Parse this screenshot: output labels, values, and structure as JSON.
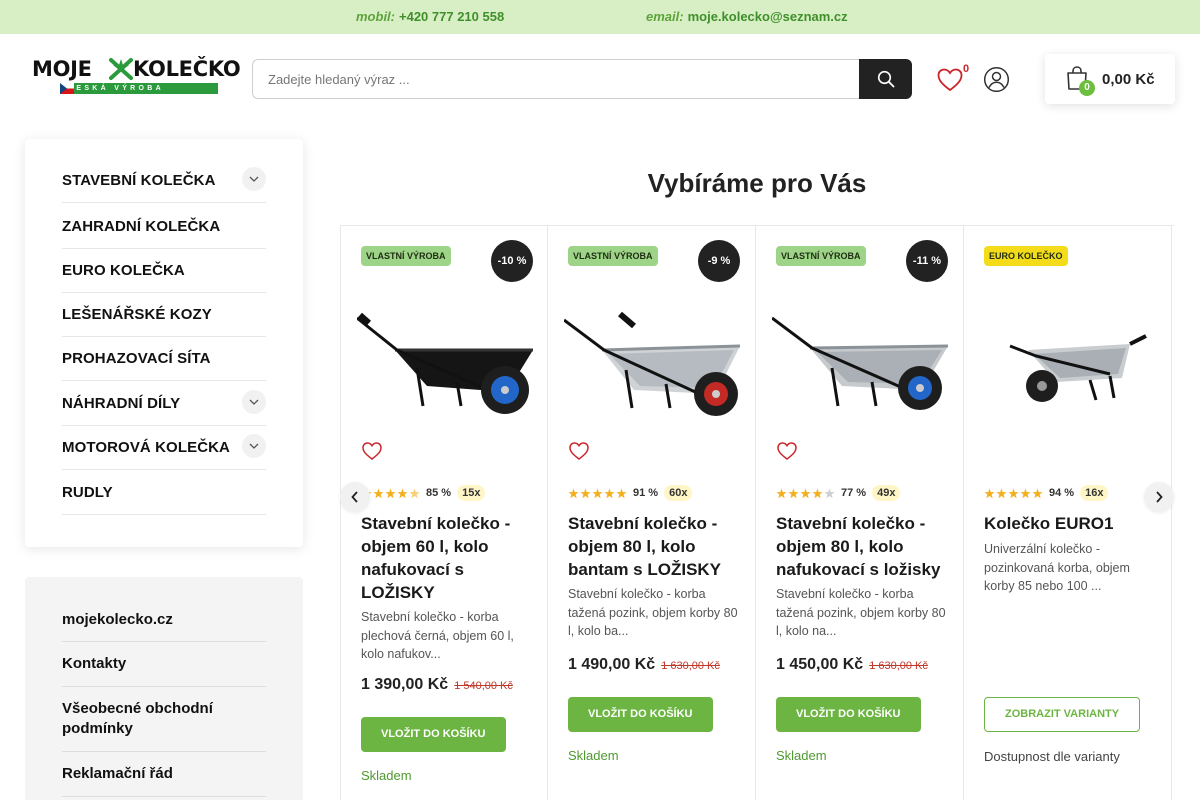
{
  "topbar": {
    "phone_label": "mobil:",
    "phone": "+420 777 210 558",
    "email_label": "email:",
    "email": "moje.kolecko@seznam.cz"
  },
  "logo": {
    "word1": "MOJE",
    "word2": "KOLEČKO",
    "tagline": "ČESKÁ VÝROBA"
  },
  "search": {
    "placeholder": "Zadejte hledaný výraz ..."
  },
  "header": {
    "wishlist_count": "0",
    "cart_count": "0",
    "cart_total": "0,00 Kč"
  },
  "sidebar": {
    "categories": [
      {
        "label": "STAVEBNÍ KOLEČKA",
        "expandable": true
      },
      {
        "label": "ZAHRADNÍ KOLEČKA",
        "expandable": false
      },
      {
        "label": "EURO KOLEČKA",
        "expandable": false
      },
      {
        "label": "LEŠENÁŘSKÉ KOZY",
        "expandable": false
      },
      {
        "label": "PROHAZOVACÍ SÍTA",
        "expandable": false
      },
      {
        "label": "NÁHRADNÍ DÍLY",
        "expandable": true
      },
      {
        "label": "MOTOROVÁ KOLEČKA",
        "expandable": true
      },
      {
        "label": "RUDLY",
        "expandable": false
      }
    ],
    "info_links": [
      "mojekolecko.cz",
      "Kontakty",
      "Všeobecné obchodní podmínky",
      "Reklamační řád"
    ]
  },
  "section": {
    "title": "Vybíráme pro Vás"
  },
  "products": [
    {
      "tag": "VLASTNÍ VÝROBA",
      "tag_color": "#9ed487",
      "discount": "-10 %",
      "image": "wheelbarrow-black-blue-wheel-icon",
      "rating_stars": 4.5,
      "rating_pct": "85 %",
      "reviews": "15x",
      "name": "Stavební kolečko - objem 60 l, kolo nafukovací s LOŽISKY",
      "desc": "Stavební kolečko - korba plechová černá, objem 60 l, kolo nafukov...",
      "price": "1 390,00 Kč",
      "old_price": "1 540,00 Kč",
      "button": "VLOŽIT DO KOŠÍKU",
      "availability": "Skladem"
    },
    {
      "tag": "VLASTNÍ VÝROBA",
      "tag_color": "#9ed487",
      "discount": "-9 %",
      "image": "wheelbarrow-galvanized-red-wheel-icon",
      "rating_stars": 5,
      "rating_pct": "91 %",
      "reviews": "60x",
      "name": "Stavební kolečko - objem 80 l, kolo bantam s LOŽISKY",
      "desc": "Stavební kolečko - korba tažená pozink, objem korby 80 l, kolo ba...",
      "price": "1 490,00 Kč",
      "old_price": "1 630,00 Kč",
      "button": "VLOŽIT DO KOŠÍKU",
      "availability": "Skladem"
    },
    {
      "tag": "VLASTNÍ VÝROBA",
      "tag_color": "#9ed487",
      "discount": "-11 %",
      "image": "wheelbarrow-galvanized-blue-wheel-icon",
      "rating_stars": 4,
      "rating_pct": "77 %",
      "reviews": "49x",
      "name": "Stavební kolečko - objem 80 l, kolo nafukovací s ložisky",
      "desc": "Stavební kolečko - korba tažená pozink, objem korby 80 l, kolo na...",
      "price": "1 450,00 Kč",
      "old_price": "1 630,00 Kč",
      "button": "VLOŽIT DO KOŠÍKU",
      "availability": "Skladem"
    },
    {
      "tag": "EURO KOLEČKO",
      "tag_color": "#f4dc1a",
      "discount": "",
      "image": "wheelbarrow-euro-galvanized-icon",
      "rating_stars": 5,
      "rating_pct": "94 %",
      "reviews": "16x",
      "name": "Kolečko EURO1",
      "desc": "Univerzální kolečko - pozinkovaná korba, objem korby 85 nebo 100 ...",
      "price": "",
      "old_price": "",
      "button": "ZOBRAZIT VARIANTY",
      "availability": "Dostupnost dle varianty"
    }
  ],
  "colors": {
    "accent_green": "#6db542",
    "topbar_bg": "#d8efc6",
    "star": "#f2b01e",
    "price_old": "#c0392b"
  }
}
